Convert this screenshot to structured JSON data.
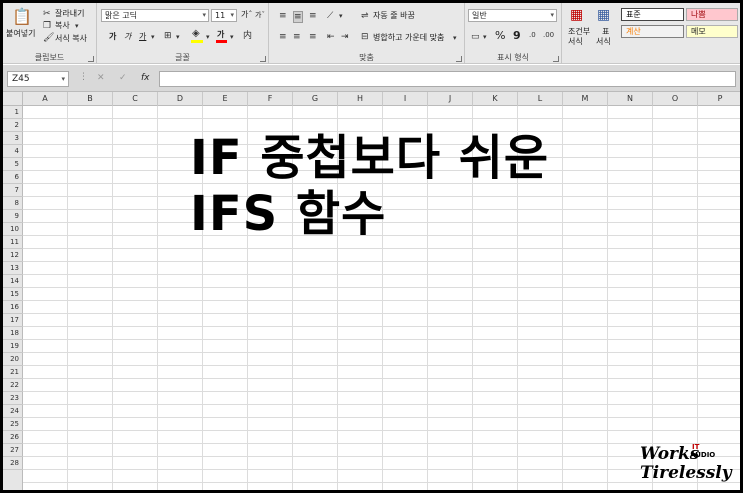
{
  "clipboard": {
    "paste_label": "붙여넣기",
    "cut_label": "잘라내기",
    "copy_label": "복사",
    "format_painter_label": "서식 복사",
    "group_label": "클립보드"
  },
  "font": {
    "font_name": "맑은 고딕",
    "font_size": "11",
    "grow_label": "가ˆ",
    "shrink_label": "가ˇ",
    "bold_label": "가",
    "italic_label": "가",
    "underline_label": "가",
    "font_color_label": "가",
    "group_label": "글꼴",
    "highlight_color": "#ffff00",
    "font_color": "#ff0000"
  },
  "alignment": {
    "wrap_text_label": "자동 줄 바꿈",
    "merge_center_label": "병합하고 가운데 맞춤",
    "group_label": "맞춤"
  },
  "number": {
    "format": "일반",
    "percent_label": "%",
    "comma_label": "9",
    "group_label": "표시 형식"
  },
  "styles": {
    "conditional_label_1": "조건부",
    "conditional_label_2": "서식",
    "table_label_1": "표",
    "table_label_2": "서식",
    "style_normal": "표준",
    "style_bad": "나쁨",
    "style_calc": "계산",
    "style_note": "메모"
  },
  "formula_bar": {
    "name_box": "Z45",
    "fx_label": "fx"
  },
  "columns": [
    "A",
    "B",
    "C",
    "D",
    "E",
    "F",
    "G",
    "H",
    "I",
    "J",
    "K",
    "L",
    "M",
    "N",
    "O",
    "P"
  ],
  "rows": [
    "1",
    "2",
    "3",
    "4",
    "5",
    "6",
    "7",
    "8",
    "9",
    "10",
    "11",
    "12",
    "13",
    "14",
    "15",
    "16",
    "17",
    "18",
    "19",
    "20",
    "21",
    "22",
    "23",
    "24",
    "25",
    "26",
    "27",
    "28"
  ],
  "title": {
    "line1": "IF 중첩보다 쉬운",
    "line2": "IFS 함수"
  },
  "watermark": {
    "works": "Works",
    "it": "IT",
    "audio": "AUDIO",
    "tirelessly": "Tirelessly"
  }
}
